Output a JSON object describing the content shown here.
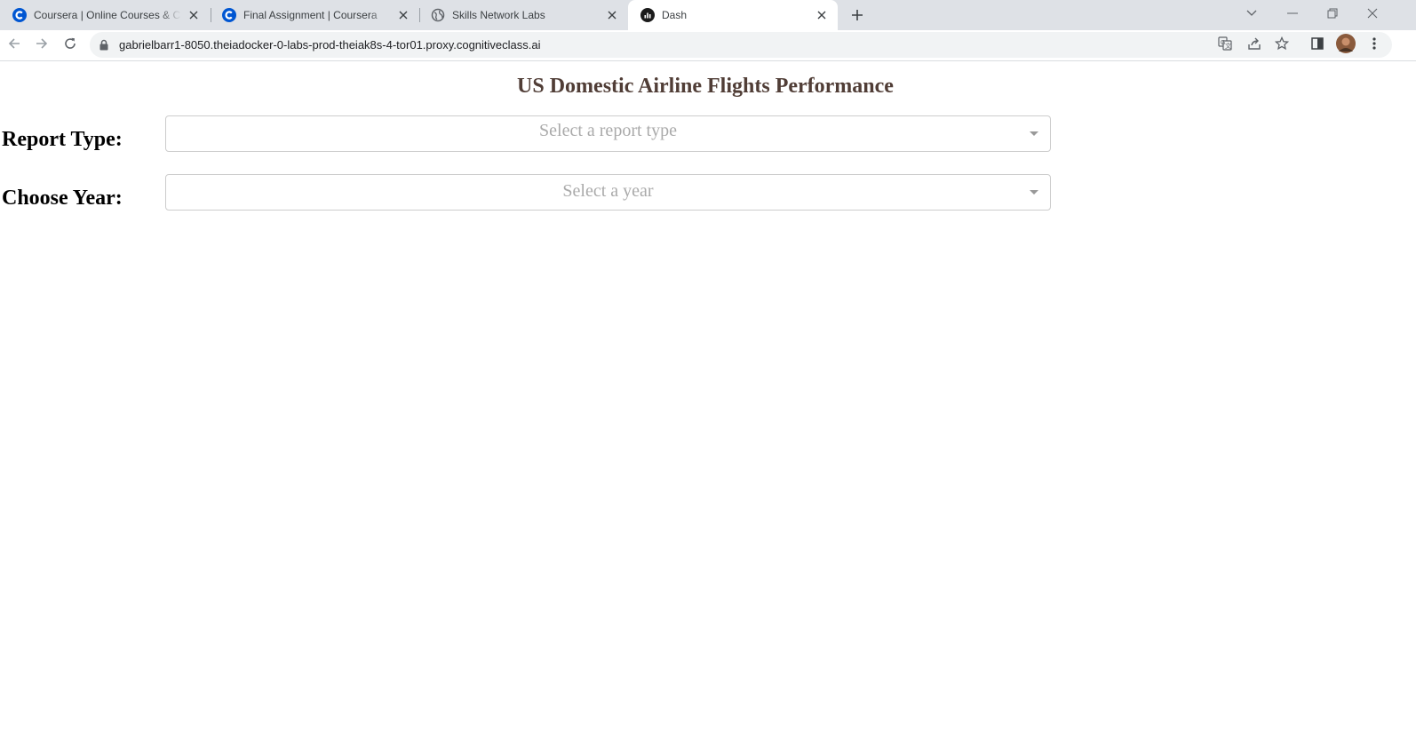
{
  "browser": {
    "tabs": [
      {
        "title": "Coursera | Online Courses & Credentials From Top Educators",
        "icon": "coursera-icon",
        "active": false
      },
      {
        "title": "Final Assignment | Coursera",
        "icon": "coursera-icon",
        "active": false
      },
      {
        "title": "Skills Network Labs",
        "icon": "globe-icon",
        "active": false
      },
      {
        "title": "Dash",
        "icon": "dash-icon",
        "active": true
      }
    ],
    "url": "gabrielbarr1-8050.theiadocker-0-labs-prod-theiak8s-4-tor01.proxy.cognitiveclass.ai"
  },
  "page": {
    "title": "US Domestic Airline Flights Performance",
    "report_type_label": "Report Type:",
    "report_type_placeholder": "Select a report type",
    "year_label": "Choose Year:",
    "year_placeholder": "Select a year"
  },
  "colors": {
    "title": "#503d36",
    "tabstrip": "#dee1e6",
    "coursera_blue": "#0056d2"
  }
}
